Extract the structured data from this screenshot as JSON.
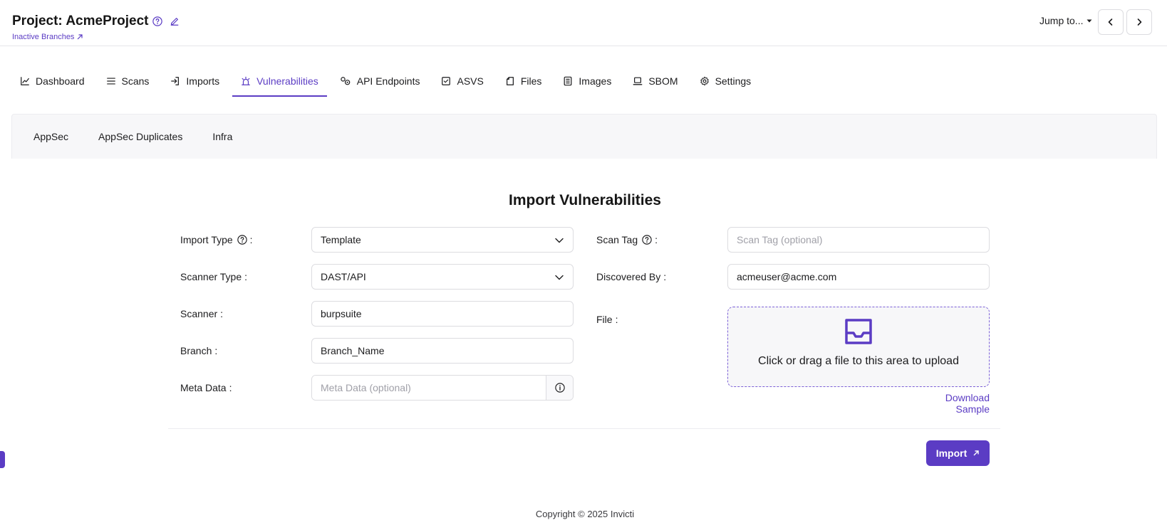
{
  "header": {
    "project_title": "Project: AcmeProject",
    "inactive_branches": "Inactive Branches",
    "jump_to": "Jump to..."
  },
  "tabs": [
    {
      "label": "Dashboard",
      "icon": "chart-line-icon"
    },
    {
      "label": "Scans",
      "icon": "list-icon"
    },
    {
      "label": "Imports",
      "icon": "import-icon"
    },
    {
      "label": "Vulnerabilities",
      "icon": "alarm-icon",
      "active": true
    },
    {
      "label": "API Endpoints",
      "icon": "api-icon"
    },
    {
      "label": "ASVS",
      "icon": "checkbox-icon"
    },
    {
      "label": "Files",
      "icon": "file-icon"
    },
    {
      "label": "Images",
      "icon": "image-list-icon"
    },
    {
      "label": "SBOM",
      "icon": "laptop-icon"
    },
    {
      "label": "Settings",
      "icon": "gear-icon"
    }
  ],
  "subtabs": [
    "AppSec",
    "AppSec Duplicates",
    "Infra"
  ],
  "form": {
    "title": "Import Vulnerabilities",
    "import_type_label": "Import Type",
    "import_type_value": "Template",
    "scanner_type_label": "Scanner Type",
    "scanner_type_value": "DAST/API",
    "scanner_label": "Scanner",
    "scanner_value": "burpsuite",
    "branch_label": "Branch",
    "branch_value": "Branch_Name",
    "meta_data_label": "Meta Data",
    "meta_data_placeholder": "Meta Data (optional)",
    "scan_tag_label": "Scan Tag",
    "scan_tag_placeholder": "Scan Tag (optional)",
    "discovered_by_label": "Discovered By",
    "discovered_by_value": "acmeuser@acme.com",
    "file_label": "File",
    "dropzone_text": "Click or drag a file to this area to upload",
    "download_sample": "Download Sample",
    "colon": ":"
  },
  "actions": {
    "import_label": "Import"
  },
  "footer": {
    "copyright": "Copyright © 2025 Invicti"
  },
  "colors": {
    "accent": "#5b3cc4"
  }
}
